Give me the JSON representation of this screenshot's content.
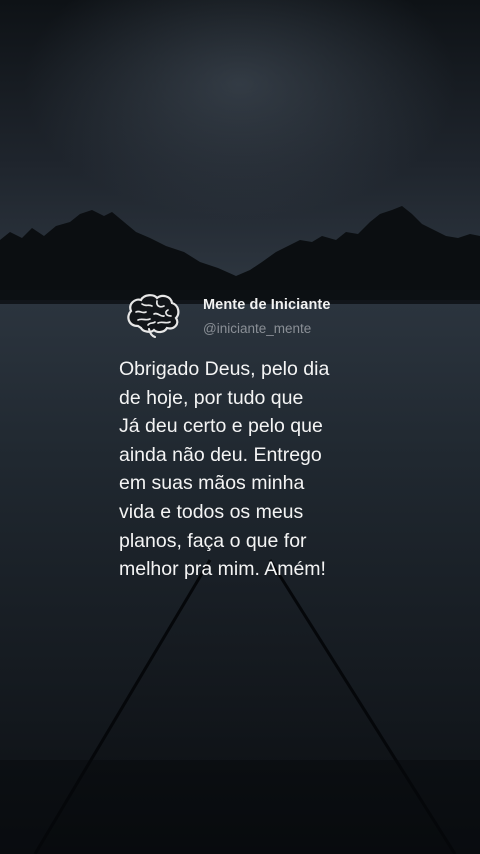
{
  "author": {
    "name": "Mente de Iniciante",
    "handle": "@iniciante_mente",
    "avatar_icon": "brain-icon"
  },
  "quote": {
    "lines": [
      "Obrigado Deus, pelo dia",
      "de hoje, por tudo que",
      "Já deu certo e pelo que",
      "ainda não deu. Entrego",
      "em suas mãos minha",
      "vida e todos os meus",
      "planos, faça o que for",
      "melhor pra mim. Amém!"
    ]
  },
  "colors": {
    "sky_top": "#101419",
    "sky_glow": "#3a4450",
    "water": "#222a33",
    "text": "#f4f4f4",
    "handle": "#8a8f96"
  }
}
